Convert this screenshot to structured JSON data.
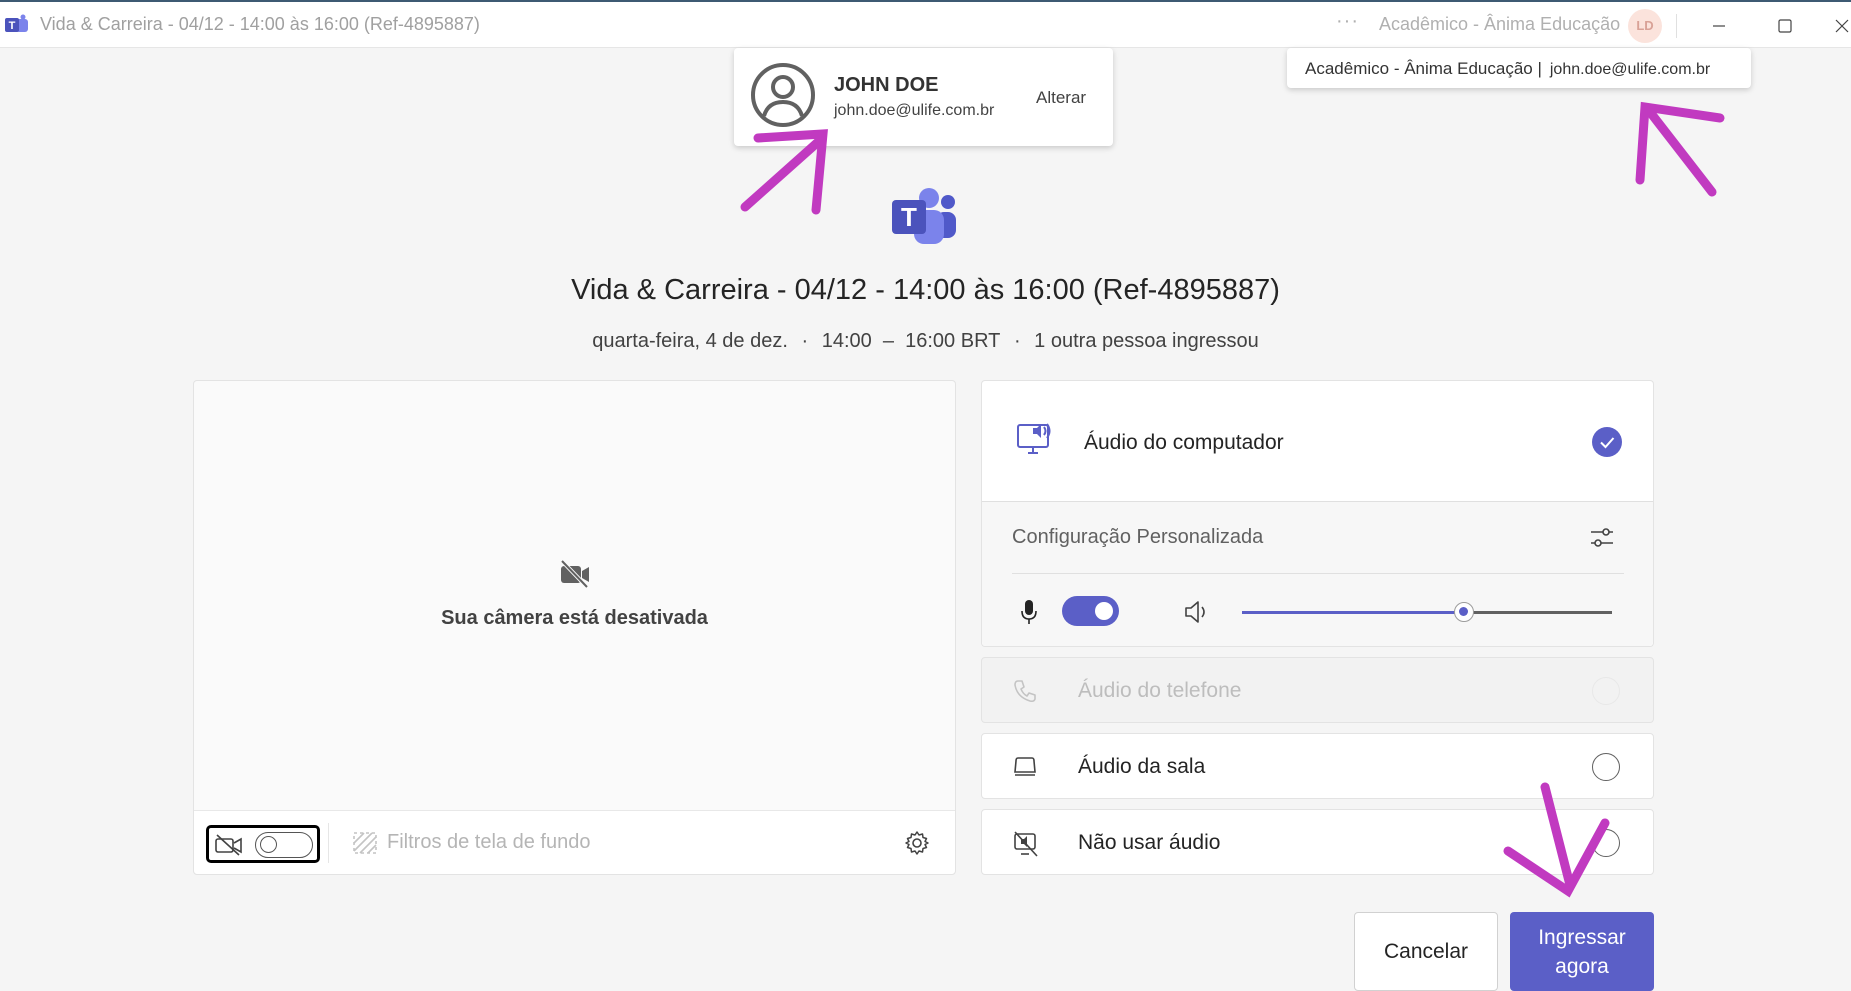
{
  "window": {
    "title": "Vida & Carreira - 04/12 - 14:00 às 16:00 (Ref-4895887)",
    "more_label": "···",
    "org_name": "Acadêmico - Ânima Educação",
    "avatar_initials": "LD"
  },
  "account": {
    "name": "JOHN DOE",
    "email": "john.doe@ulife.com.br",
    "change_label": "Alterar"
  },
  "tooltip": {
    "org": "Acadêmico - Ânima Educação |",
    "email": "john.doe@ulife.com.br"
  },
  "meeting": {
    "title": "Vida & Carreira - 04/12 - 14:00 às 16:00 (Ref-4895887)",
    "date": "quarta-feira, 4 de dez.",
    "dot": "·",
    "time": "14:00  –  16:00 BRT",
    "participants": "1 outra pessoa ingressou"
  },
  "video": {
    "camera_off_text": "Sua câmera está desativada",
    "camera_on": false,
    "background_filters_label": "Filtros de tela de fundo"
  },
  "audio": {
    "computer": {
      "label": "Áudio do computador",
      "selected": true,
      "custom_config_label": "Configuração Personalizada",
      "mic_on": true,
      "volume_fraction": 0.6
    },
    "options": [
      {
        "label": "Áudio do telefone",
        "disabled": true,
        "icon": "phone-icon"
      },
      {
        "label": "Áudio da sala",
        "disabled": false,
        "icon": "room-device-icon"
      },
      {
        "label": "Não usar áudio",
        "disabled": false,
        "icon": "no-audio-icon"
      }
    ]
  },
  "buttons": {
    "cancel": "Cancelar",
    "join": "Ingressar agora"
  },
  "colors": {
    "accent": "#5b5fc7",
    "annotation": "#c13ac0"
  }
}
